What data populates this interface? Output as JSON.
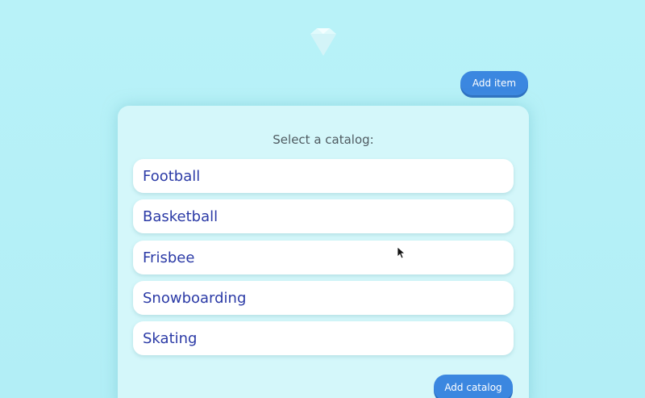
{
  "header": {
    "logo_icon": "diamond-icon",
    "add_item_label": "Add item"
  },
  "catalog_panel": {
    "title": "Select a catalog:",
    "items": [
      {
        "label": "Football"
      },
      {
        "label": "Basketball"
      },
      {
        "label": "Frisbee"
      },
      {
        "label": "Snowboarding"
      },
      {
        "label": "Skating"
      }
    ],
    "add_catalog_label": "Add catalog"
  },
  "colors": {
    "background": "#b6f1f8",
    "panel": "#d4f7fa",
    "accent": "#3b87e0",
    "item_text": "#2b3aa6"
  }
}
